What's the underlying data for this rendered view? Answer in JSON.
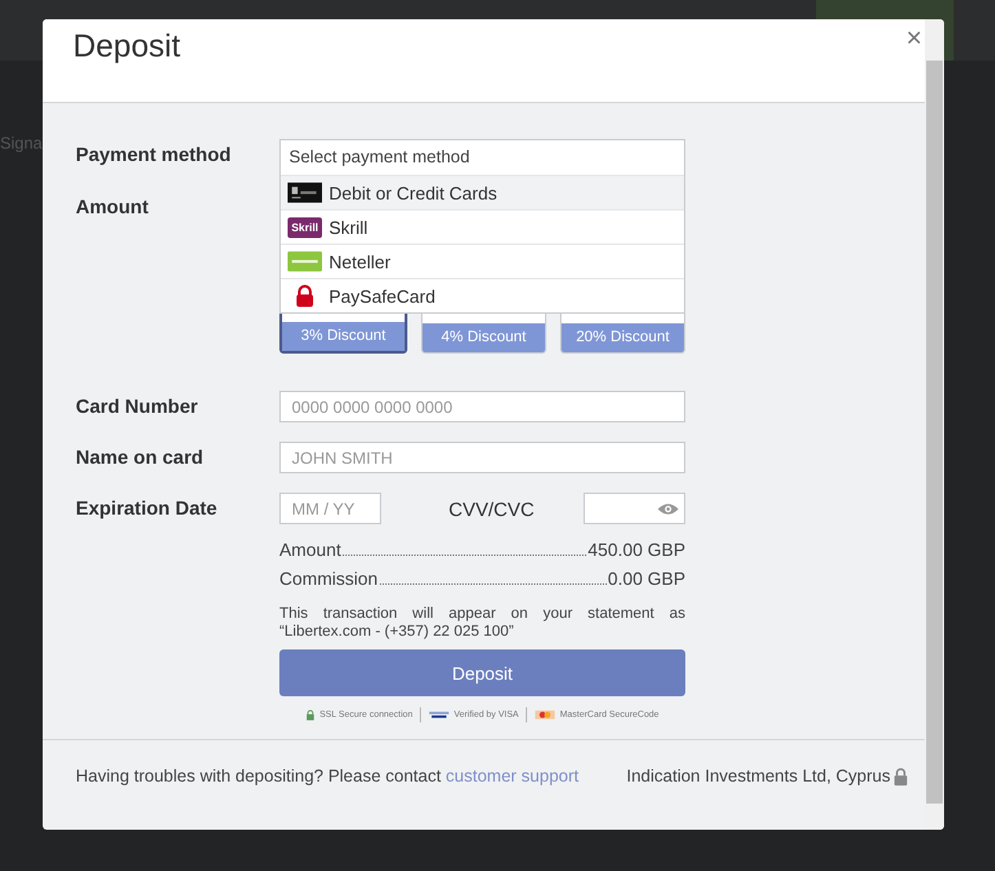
{
  "background": {
    "side_label": "Signa"
  },
  "dialog": {
    "title": "Deposit",
    "close": "×"
  },
  "payment_method": {
    "label": "Payment method",
    "placeholder": "Select payment method",
    "options": [
      {
        "label": "Debit or Credit Cards",
        "kind": "card",
        "selected": true
      },
      {
        "label": "Skrill",
        "kind": "skrill",
        "logo_text": "Skrill",
        "selected": false
      },
      {
        "label": "Neteller",
        "kind": "neteller",
        "selected": false
      },
      {
        "label": "PaySafeCard",
        "kind": "paysafe",
        "selected": false
      }
    ]
  },
  "amount": {
    "label": "Amount",
    "options": [
      {
        "discount": "3% Discount",
        "selected": true
      },
      {
        "discount": "4% Discount",
        "selected": false
      },
      {
        "discount": "20% Discount",
        "selected": false
      }
    ]
  },
  "card_number": {
    "label": "Card Number",
    "placeholder": "0000 0000 0000 0000"
  },
  "name_on_card": {
    "label": "Name on card",
    "placeholder": "JOHN SMITH"
  },
  "expiration": {
    "label": "Expiration Date",
    "placeholder": "MM / YY"
  },
  "cvv": {
    "label": "CVV/CVC"
  },
  "summary": [
    {
      "label": "Amount",
      "value": "450.00 GBP"
    },
    {
      "label": "Commission",
      "value": "0.00 GBP"
    }
  ],
  "statement_note": "This transaction will appear on your statement as “Libertex.com - (+357) 22 025 100”",
  "submit": "Deposit",
  "secure_badges": [
    {
      "kind": "ssl",
      "text": "SSL Secure connection"
    },
    {
      "kind": "visa",
      "text": "Verified by VISA"
    },
    {
      "kind": "mastercard",
      "text": "MasterCard SecureCode"
    }
  ],
  "footer": {
    "help_text": "Having troubles with depositing? Please contact",
    "link": "customer support",
    "company": "Indication Investments Ltd, Cyprus"
  }
}
